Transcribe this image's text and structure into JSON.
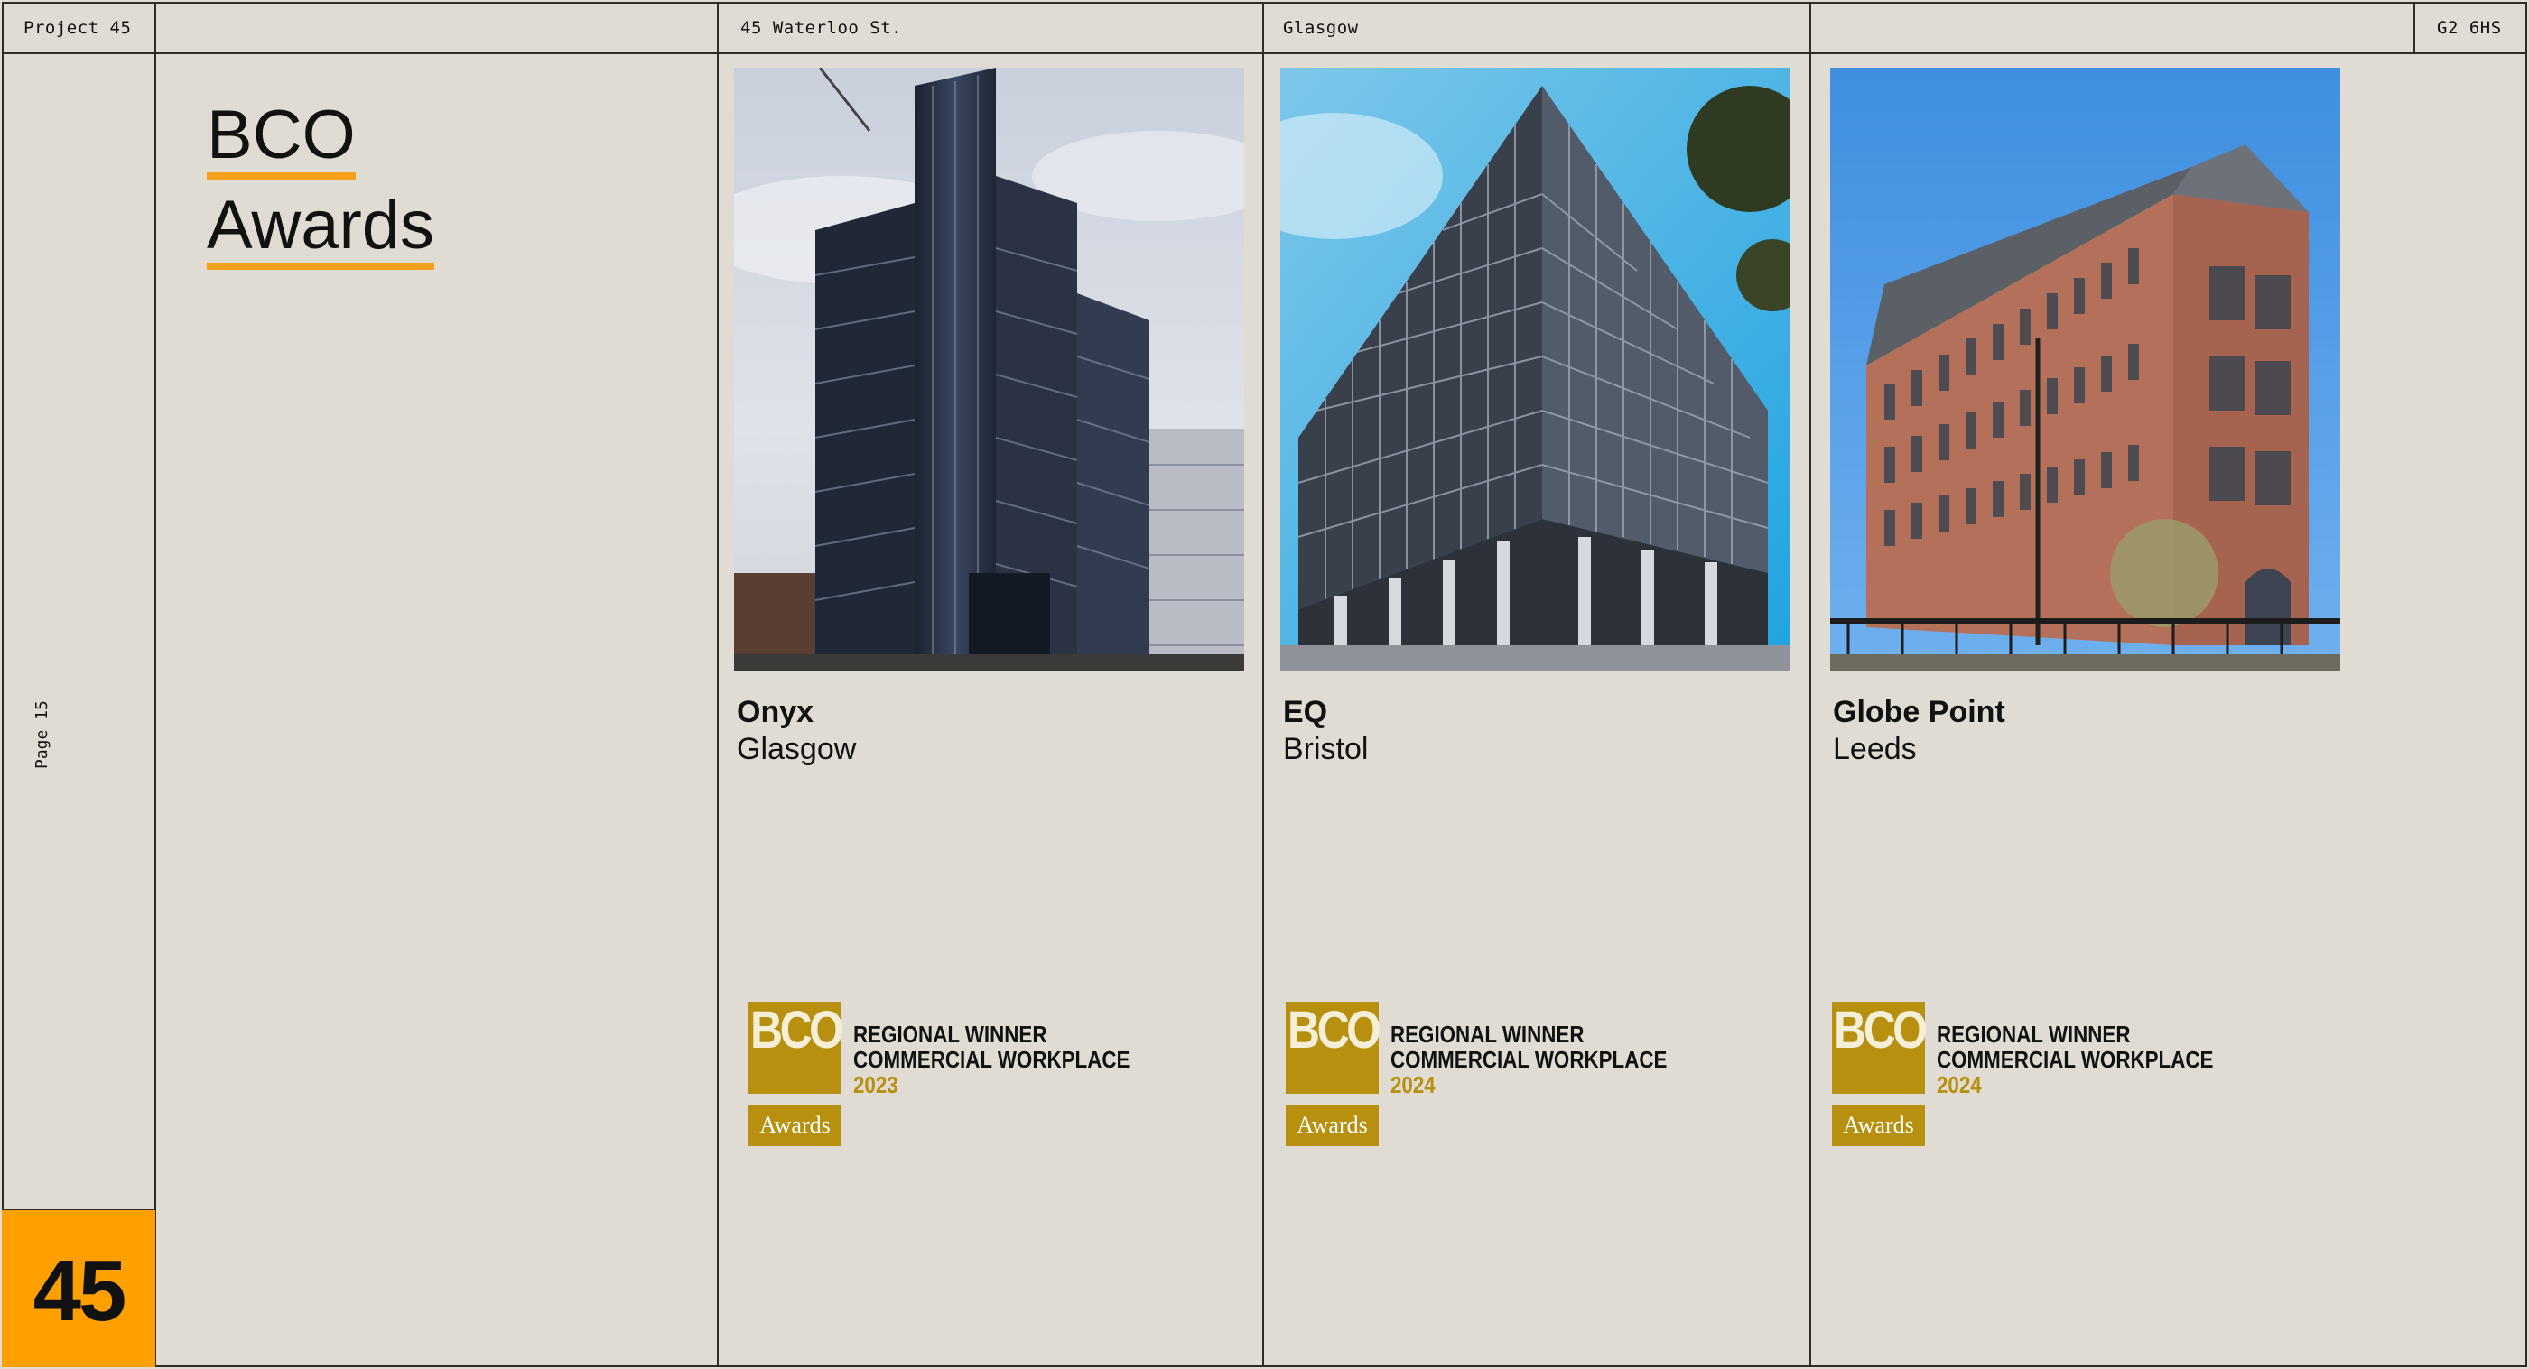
{
  "header": {
    "project": "Project 45",
    "address": "45 Waterloo St.",
    "city": "Glasgow",
    "postcode": "G2 6HS"
  },
  "sidebar": {
    "page_label": "Page 15",
    "page_number": "45"
  },
  "section": {
    "title_line1": "BCO",
    "title_line2": "Awards"
  },
  "projects": [
    {
      "name": "Onyx",
      "city": "Glasgow",
      "badge": {
        "logo": "BCO",
        "line1": "REGIONAL WINNER",
        "line2": "COMMERCIAL WORKPLACE",
        "year": "2023",
        "awards": "Awards"
      }
    },
    {
      "name": "EQ",
      "city": "Bristol",
      "badge": {
        "logo": "BCO",
        "line1": "REGIONAL WINNER",
        "line2": "COMMERCIAL WORKPLACE",
        "year": "2024",
        "awards": "Awards"
      }
    },
    {
      "name": "Globe Point",
      "city": "Leeds",
      "badge": {
        "logo": "BCO",
        "line1": "REGIONAL WINNER",
        "line2": "COMMERCIAL WORKPLACE",
        "year": "2024",
        "awards": "Awards"
      }
    }
  ],
  "colors": {
    "background": "#e0dbd3",
    "accent_orange": "#ff9f00",
    "underline_orange": "#f7a01c",
    "bco_gold": "#b8900f",
    "rule": "#2f2d2a"
  }
}
